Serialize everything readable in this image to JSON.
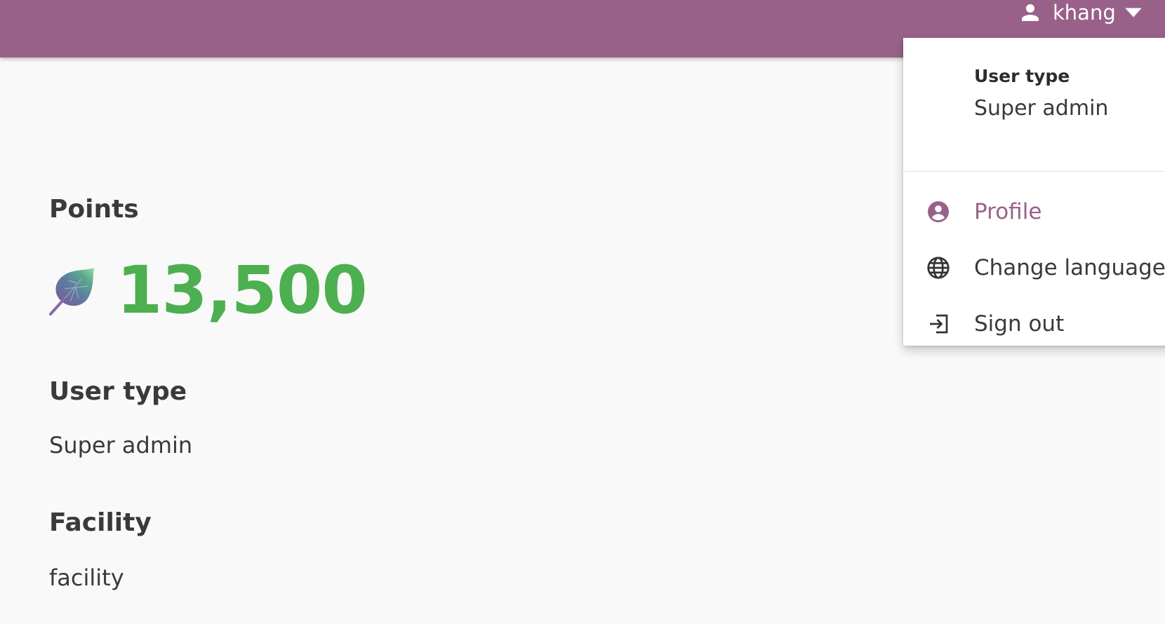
{
  "app_bar": {
    "user_menu": {
      "username": "khang",
      "user_icon": "person-icon",
      "caret_icon": "caret-down-icon"
    },
    "color": "#996189"
  },
  "user_dropdown": {
    "header_label": "User type",
    "header_value": "Super admin",
    "items": [
      {
        "label": "Profile",
        "icon": "account-circle-icon",
        "active": true
      },
      {
        "label": "Change language",
        "icon": "globe-icon",
        "active": false
      },
      {
        "label": "Sign out",
        "icon": "logout-icon",
        "active": false
      }
    ]
  },
  "profile": {
    "points": {
      "title": "Points",
      "value": "13,500",
      "icon": "leaf-icon",
      "color": "#4caf50"
    },
    "user_type": {
      "title": "User type",
      "value": "Super admin"
    },
    "facility": {
      "title": "Facility",
      "value": "facility"
    }
  },
  "colors": {
    "brand": "#996189",
    "points_green": "#4caf50",
    "background": "#f9f9f9"
  }
}
